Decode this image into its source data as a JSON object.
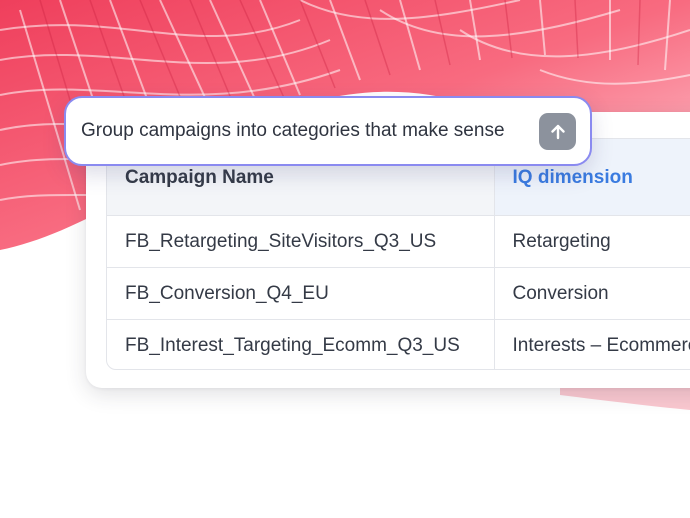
{
  "prompt": {
    "text": "Group campaigns into categories that make sense",
    "send_icon": "arrow-up-icon"
  },
  "table": {
    "headers": [
      "Campaign Name",
      "IQ dimension"
    ],
    "rows": [
      [
        "FB_Retargeting_SiteVisitors_Q3_US",
        "Retargeting"
      ],
      [
        "FB_Conversion_Q4_EU",
        "Conversion"
      ],
      [
        "FB_Interest_Targeting_Ecomm_Q3_US",
        "Interests – Ecommerce"
      ]
    ]
  },
  "colors": {
    "accent_header": "#3a7be0",
    "prompt_border": "#8a8af0",
    "background_swirl": "#f0566e"
  }
}
